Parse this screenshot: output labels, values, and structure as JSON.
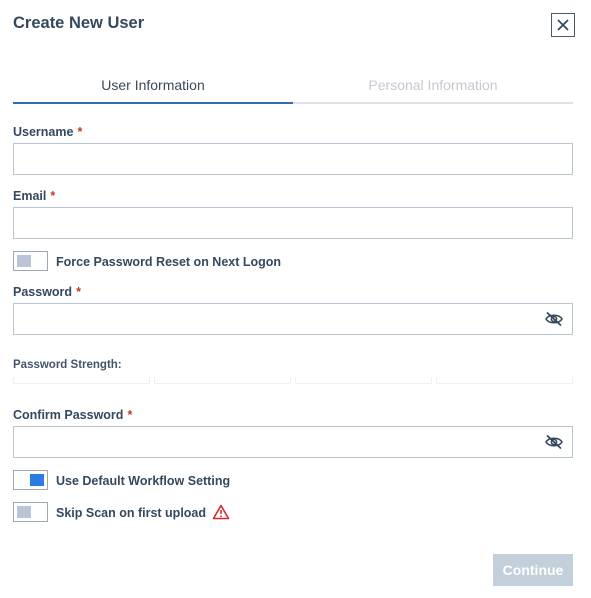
{
  "dialog": {
    "title": "Create New User"
  },
  "tabs": [
    {
      "label": "User Information",
      "active": true
    },
    {
      "label": "Personal Information",
      "active": false
    }
  ],
  "fields": {
    "username": {
      "label": "Username",
      "required_mark": "*",
      "value": ""
    },
    "email": {
      "label": "Email",
      "required_mark": "*",
      "value": ""
    },
    "password": {
      "label": "Password",
      "required_mark": "*",
      "value": ""
    },
    "confirm_password": {
      "label": "Confirm Password",
      "required_mark": "*",
      "value": ""
    }
  },
  "toggles": {
    "force_reset": {
      "label": "Force Password Reset on Next Logon",
      "on": false
    },
    "default_workflow": {
      "label": "Use Default Workflow Setting",
      "on": true
    },
    "skip_scan": {
      "label": "Skip Scan on first upload",
      "on": false
    }
  },
  "password_strength": {
    "label": "Password Strength:",
    "segments": 4
  },
  "buttons": {
    "continue": "Continue"
  },
  "icons": {
    "close": "close-icon",
    "eye": "eye-slash-icon",
    "warning": "warning-triangle-icon"
  },
  "colors": {
    "accent": "#2d6db8",
    "required": "#c0392b",
    "toggle_on": "#2d7ae6",
    "warning": "#d9292b",
    "button_disabled": "#c4cfdc"
  }
}
